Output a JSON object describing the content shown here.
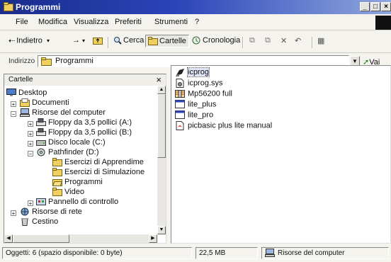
{
  "window": {
    "title": "Programmi"
  },
  "menu": [
    {
      "label": "File",
      "key": "F"
    },
    {
      "label": "Modifica",
      "key": "M"
    },
    {
      "label": "Visualizza",
      "key": "V"
    },
    {
      "label": "Preferiti",
      "key": "P"
    },
    {
      "label": "Strumenti",
      "key": "S"
    },
    {
      "label": "?",
      "key": ""
    }
  ],
  "toolbar": {
    "back_label": "Indietro",
    "search_label": "Cerca",
    "folders_label": "Cartelle",
    "history_label": "Cronologia"
  },
  "address": {
    "label": "Indirizzo",
    "value": "Programmi",
    "go_label": "Vai"
  },
  "tree": {
    "header": "Cartelle",
    "close": "×",
    "items": [
      {
        "label": "Desktop",
        "icon": "desktop-icon"
      },
      {
        "label": "Documenti",
        "icon": "documents-folder-icon"
      },
      {
        "label": "Risorse del computer",
        "icon": "computer-icon"
      },
      {
        "label": "Floppy da 3,5 pollici (A:)",
        "icon": "floppy-drive-icon"
      },
      {
        "label": "Floppy da 3,5 pollici (B:)",
        "icon": "floppy-drive-icon"
      },
      {
        "label": "Disco locale (C:)",
        "icon": "hard-disk-icon"
      },
      {
        "label": "Pathfinder (D:)",
        "icon": "cd-drive-icon"
      },
      {
        "label": "Esercizi di Apprendime",
        "icon": "folder-icon"
      },
      {
        "label": "Esercizi di Simulazione",
        "icon": "folder-icon"
      },
      {
        "label": "Programmi",
        "icon": "open-folder-icon"
      },
      {
        "label": "Video",
        "icon": "folder-icon"
      },
      {
        "label": "Pannello di controllo",
        "icon": "control-panel-icon"
      },
      {
        "label": "Risorse di rete",
        "icon": "network-icon"
      },
      {
        "label": "Cestino",
        "icon": "recycle-bin-icon"
      }
    ]
  },
  "files": [
    {
      "name": "icprog",
      "icon": "chip-programmer-icon",
      "selected": true
    },
    {
      "name": "icprog.sys",
      "icon": "system-file-icon"
    },
    {
      "name": "Mp56200 full",
      "icon": "archive-icon"
    },
    {
      "name": "lite_plus",
      "icon": "app-icon"
    },
    {
      "name": "lite_pro",
      "icon": "app-icon"
    },
    {
      "name": "picbasic plus lite manual",
      "icon": "pdf-icon"
    }
  ],
  "status": {
    "objects": "Oggetti: 6 (spazio disponibile: 0 byte)",
    "size": "22,5 MB",
    "location": "Risorse del computer"
  },
  "colors": {
    "title_start": "#1a2d8c",
    "title_end": "#8fa6de",
    "folder": "#f0d060"
  }
}
